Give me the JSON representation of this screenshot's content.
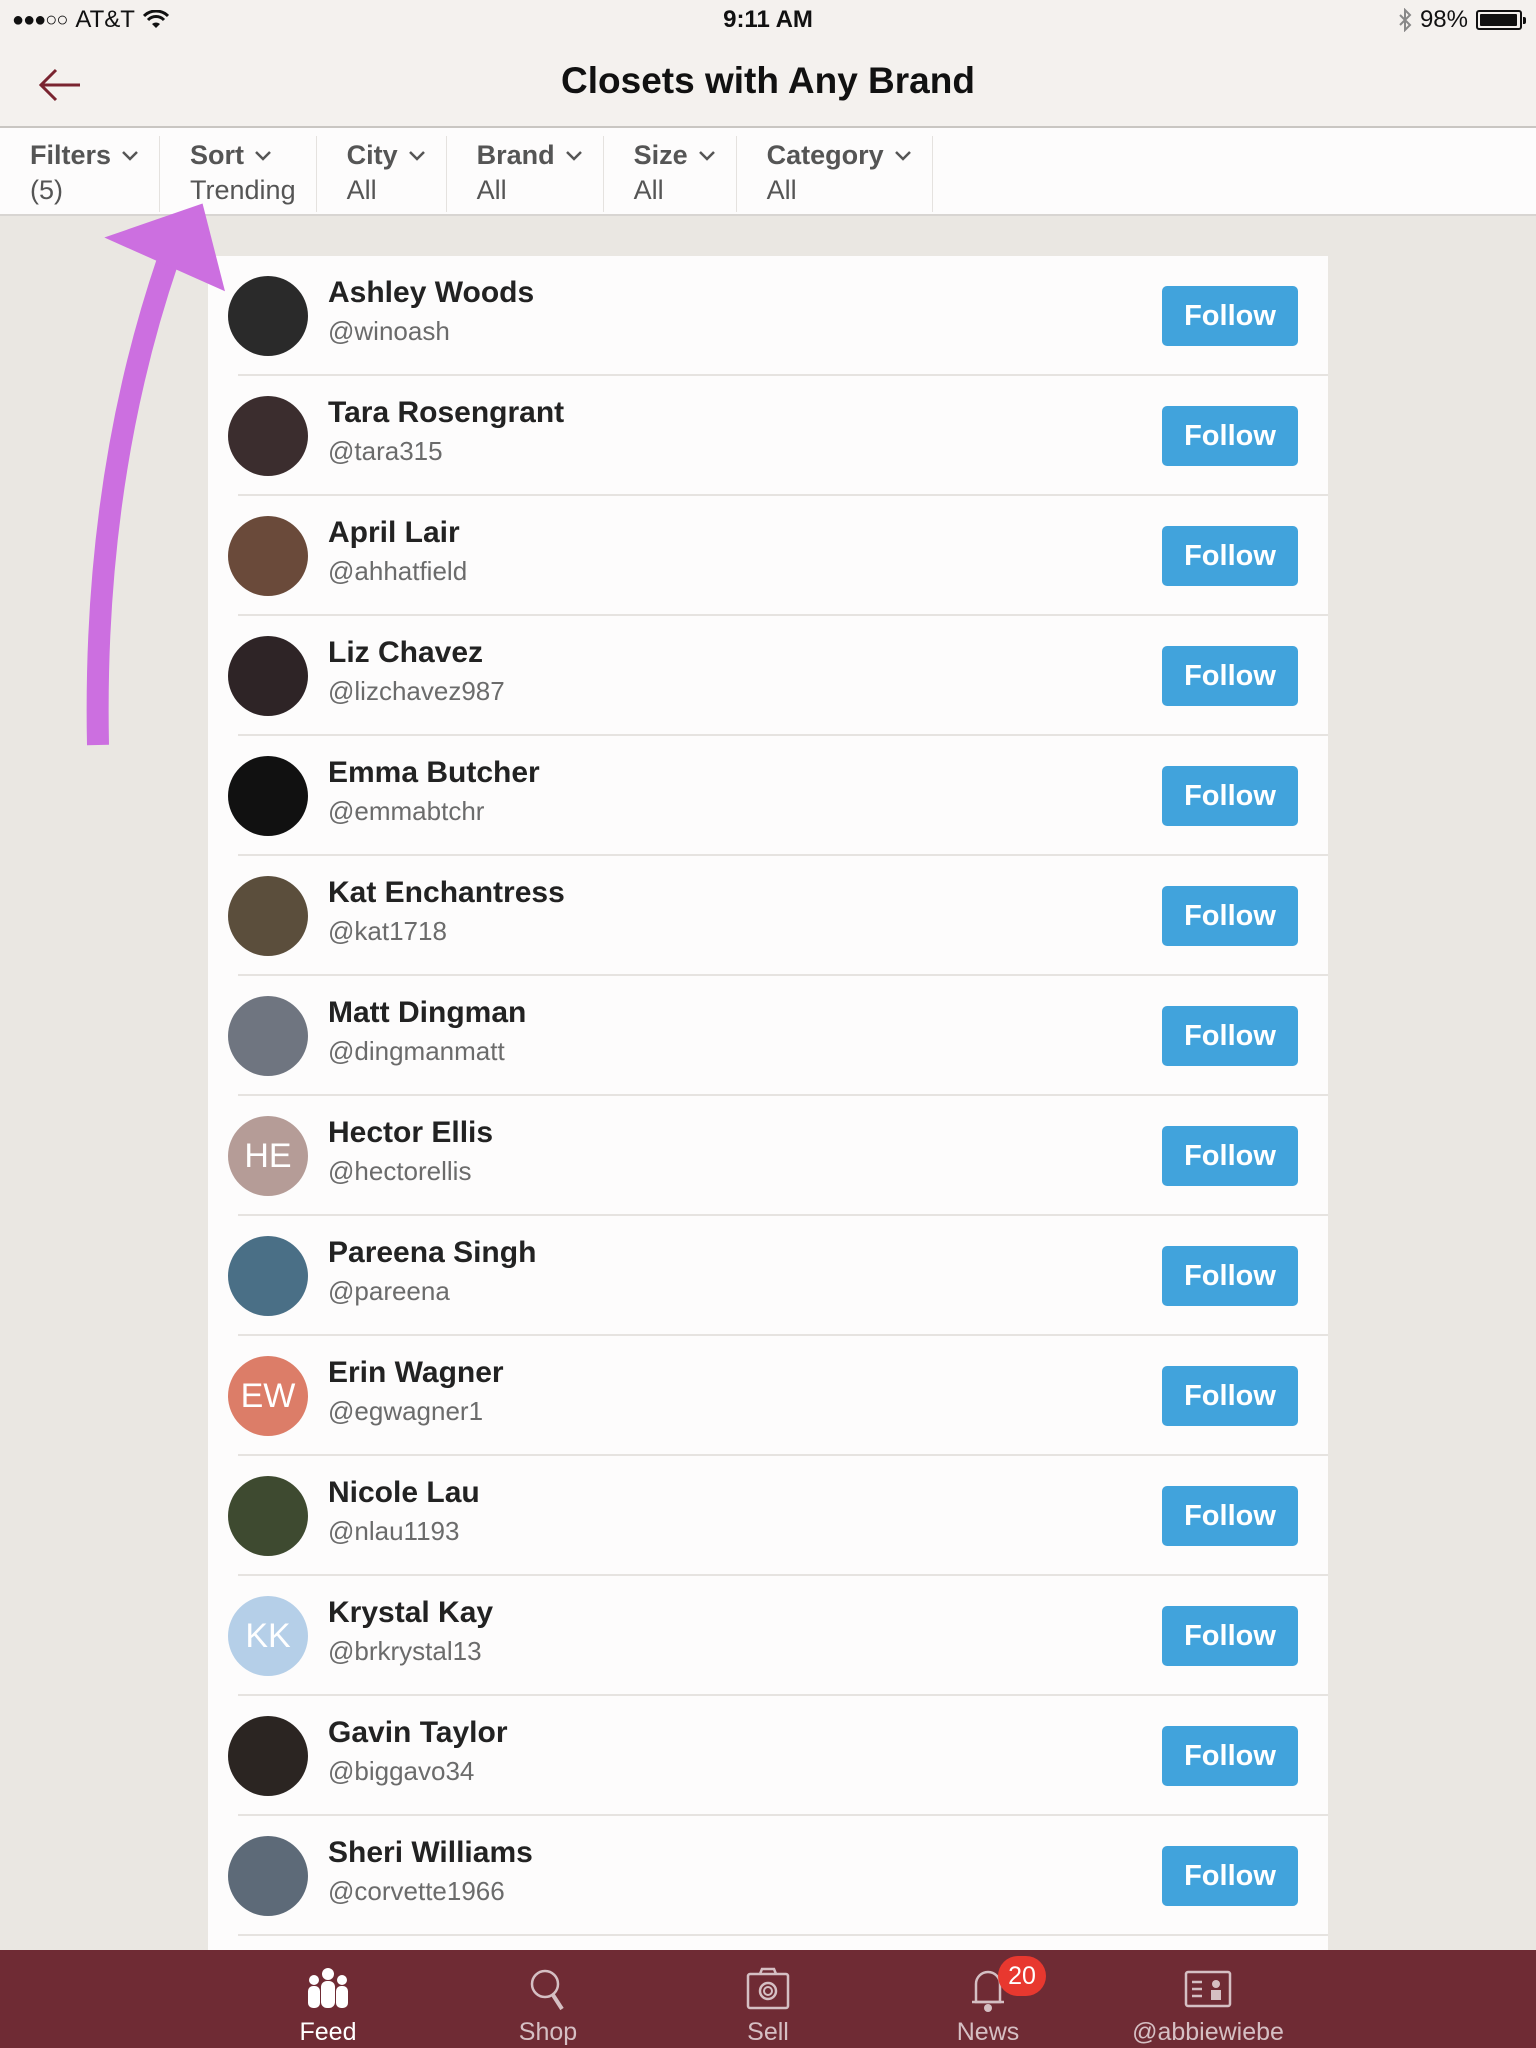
{
  "status_bar": {
    "signal": "●●●○○",
    "carrier": "AT&T",
    "time": "9:11 AM",
    "battery_percent": "98%",
    "battery_level": 0.98
  },
  "header": {
    "title": "Closets with Any Brand",
    "back_icon": "arrow-left-icon"
  },
  "filters": [
    {
      "label": "Filters",
      "value": "(5)"
    },
    {
      "label": "Sort",
      "value": "Trending"
    },
    {
      "label": "City",
      "value": "All"
    },
    {
      "label": "Brand",
      "value": "All"
    },
    {
      "label": "Size",
      "value": "All"
    },
    {
      "label": "Category",
      "value": "All"
    }
  ],
  "users": [
    {
      "name": "Ashley Woods",
      "handle": "@winoash",
      "initials": "",
      "avatar_color": "#2a2a2a",
      "follow_label": "Follow"
    },
    {
      "name": "Tara Rosengrant",
      "handle": "@tara315",
      "initials": "",
      "avatar_color": "#3b2d2e",
      "follow_label": "Follow"
    },
    {
      "name": "April Lair",
      "handle": "@ahhatfield",
      "initials": "",
      "avatar_color": "#6a4a3a",
      "follow_label": "Follow"
    },
    {
      "name": "Liz Chavez",
      "handle": "@lizchavez987",
      "initials": "",
      "avatar_color": "#2e2426",
      "follow_label": "Follow"
    },
    {
      "name": "Emma Butcher",
      "handle": "@emmabtchr",
      "initials": "",
      "avatar_color": "#111111",
      "follow_label": "Follow"
    },
    {
      "name": "Kat Enchantress",
      "handle": "@kat1718",
      "initials": "",
      "avatar_color": "#5b4e3c",
      "follow_label": "Follow"
    },
    {
      "name": "Matt Dingman",
      "handle": "@dingmanmatt",
      "initials": "",
      "avatar_color": "#6f7580",
      "follow_label": "Follow"
    },
    {
      "name": "Hector Ellis",
      "handle": "@hectorellis",
      "initials": "HE",
      "avatar_color": "#b59c97",
      "follow_label": "Follow"
    },
    {
      "name": "Pareena Singh",
      "handle": "@pareena",
      "initials": "",
      "avatar_color": "#4a6f86",
      "follow_label": "Follow"
    },
    {
      "name": "Erin Wagner",
      "handle": "@egwagner1",
      "initials": "EW",
      "avatar_color": "#dc7d68",
      "follow_label": "Follow"
    },
    {
      "name": "Nicole Lau",
      "handle": "@nlau1193",
      "initials": "",
      "avatar_color": "#3e4a30",
      "follow_label": "Follow"
    },
    {
      "name": "Krystal Kay",
      "handle": "@brkrystal13",
      "initials": "KK",
      "avatar_color": "#b5cfe8",
      "follow_label": "Follow"
    },
    {
      "name": "Gavin Taylor",
      "handle": "@biggavo34",
      "initials": "",
      "avatar_color": "#2b2522",
      "follow_label": "Follow"
    },
    {
      "name": "Sheri Williams",
      "handle": "@corvette1966",
      "initials": "",
      "avatar_color": "#5d6a78",
      "follow_label": "Follow"
    }
  ],
  "tab_bar": {
    "tabs": [
      {
        "label": "Feed",
        "icon": "people-icon",
        "active": true
      },
      {
        "label": "Shop",
        "icon": "search-icon",
        "active": false
      },
      {
        "label": "Sell",
        "icon": "camera-icon",
        "active": false
      },
      {
        "label": "News",
        "icon": "bell-icon",
        "active": false,
        "badge": "20"
      },
      {
        "label": "@abbiewiebe",
        "icon": "profile-card-icon",
        "active": false
      }
    ]
  },
  "colors": {
    "follow_button": "#41a3dc",
    "tab_bar": "#6f2b34",
    "badge": "#e8382f",
    "annotation_arrow": "#cc6fe0",
    "back_arrow": "#7a2430"
  }
}
